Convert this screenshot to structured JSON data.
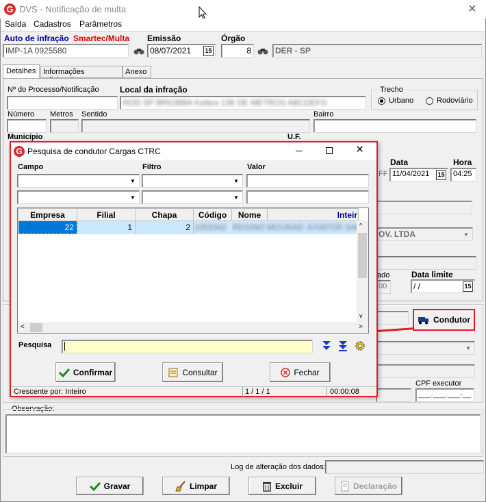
{
  "window": {
    "title": "DVS - Notificação de multa",
    "close_glyph": "×"
  },
  "menu": [
    "Saída",
    "Cadastros",
    "Parâmetros"
  ],
  "header": {
    "auto_label": "Auto de infração",
    "smartec_label": "Smartec/Multa",
    "auto_value": "IMP-1A 0925580",
    "emissao_label": "Emissão",
    "emissao_value": "08/07/2021",
    "orgao_label": "Órgão",
    "orgao_value": "8",
    "orgao_name": "DER - SP",
    "cal_glyph": "15"
  },
  "tabs": [
    "Detalhes",
    "Informações adicionais",
    "Anexo"
  ],
  "details": {
    "processo_label": "Nº do Processo/Notificação",
    "local_label": "Local da infração",
    "local_value": "ROD SP BRIOBBA Ketbra 136 DE METROS ABCDEFG",
    "trecho_label": "Trecho",
    "urbano_label": "Urbano",
    "rodoviario_label": "Rodoviário",
    "numero_label": "Número",
    "metros_label": "Metros",
    "sentido_label": "Sentido",
    "bairro_label": "Bairro",
    "municipio_label": "Município",
    "uf_label": "U.F.",
    "data_label": "Data",
    "data_value": "11/04/2021",
    "hora_label": "Hora",
    "hora_value": "04:25",
    "empresa_partial": "OV. LTDA",
    "ado_label": "ado",
    "data_limite_label": "Data limite",
    "data_limite_value": " / /",
    "value_00": "00",
    "condutor_label": "Condutor",
    "cpf_label": "CPF executor",
    "cpf_value": "___.___.___-__",
    "ff_label": "FF",
    "observacao_label": "Observação:",
    "log_label": "Log de alteração dos dados:"
  },
  "bottom_buttons": {
    "gravar": "Gravar",
    "limpar": "Limpar",
    "excluir": "Excluir",
    "declaracao": "Declaração"
  },
  "dialog": {
    "title": "Pesquisa de condutor Cargas CTRC",
    "campo_label": "Campo",
    "filtro_label": "Filtro",
    "valor_label": "Valor",
    "columns": [
      "Empresa",
      "Filial",
      "Chapa",
      "Código",
      "Nome",
      "Inteir"
    ],
    "rows": [
      {
        "empresa": "22",
        "filial": "1",
        "chapa": "2",
        "codigo": "1053342",
        "nome": "REGINO MOURAD JUVATOR SAMPAIO"
      }
    ],
    "pesquisa_label": "Pesquisa",
    "confirmar": "Confirmar",
    "consultar": "Consultar",
    "fechar": "Fechar",
    "status_left": "Crescente por: Inteiro",
    "status_mid": "1 / 1 / 1",
    "status_time": "00:00:08"
  },
  "colors": {
    "highlight_red": "#e01b24",
    "smartec_red": "#e00000",
    "header_blue": "#00009c",
    "selection_blue": "#0078d7",
    "row_highlight": "#cce8ff",
    "pesquisa_bg": "#ffffcc"
  }
}
